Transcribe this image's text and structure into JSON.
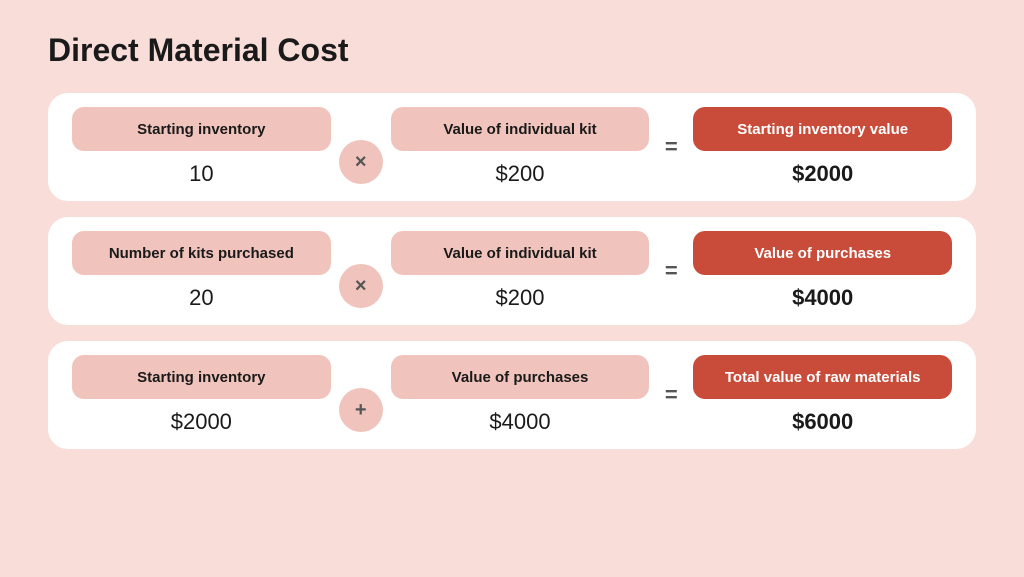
{
  "title": "Direct Material Cost",
  "rows": [
    {
      "cells": [
        {
          "label": "Starting inventory",
          "value": "10",
          "accent": false,
          "bold": false
        },
        {
          "operator": "×"
        },
        {
          "label": "Value of individual kit",
          "value": "$200",
          "accent": false,
          "bold": false
        },
        {
          "equals": "="
        },
        {
          "label": "Starting inventory value",
          "value": "$2000",
          "accent": true,
          "bold": true
        }
      ]
    },
    {
      "cells": [
        {
          "label": "Number of kits purchased",
          "value": "20",
          "accent": false,
          "bold": false
        },
        {
          "operator": "×"
        },
        {
          "label": "Value of individual kit",
          "value": "$200",
          "accent": false,
          "bold": false
        },
        {
          "equals": "="
        },
        {
          "label": "Value of purchases",
          "value": "$4000",
          "accent": true,
          "bold": true
        }
      ]
    },
    {
      "cells": [
        {
          "label": "Starting inventory",
          "value": "$2000",
          "accent": false,
          "bold": false
        },
        {
          "operator": "+"
        },
        {
          "label": "Value of purchases",
          "value": "$4000",
          "accent": false,
          "bold": false
        },
        {
          "equals": "="
        },
        {
          "label": "Total value of raw materials",
          "value": "$6000",
          "accent": true,
          "bold": true
        }
      ]
    }
  ]
}
